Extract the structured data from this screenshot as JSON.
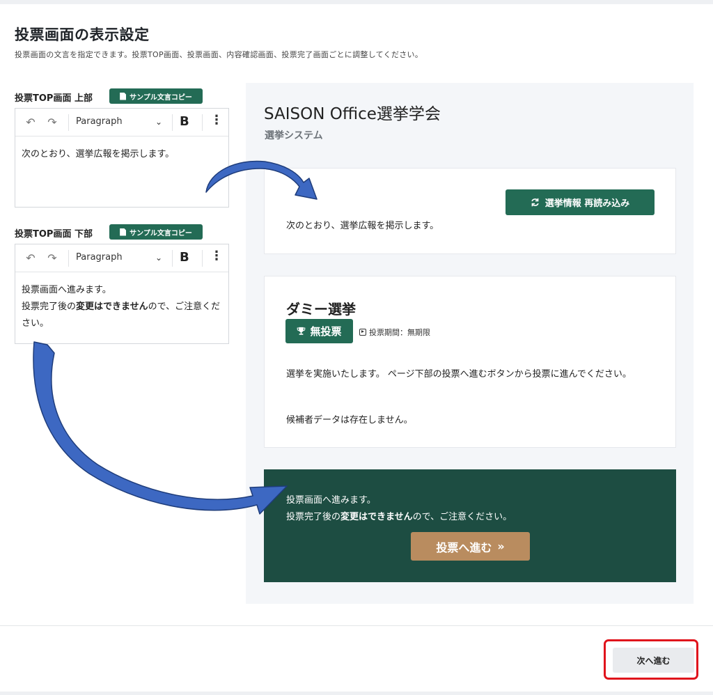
{
  "page": {
    "title": "投票画面の表示設定",
    "description": "投票画面の文言を指定できます。投票TOP画面、投票画面、内容確認画面、投票完了画面ごとに調整してください。"
  },
  "editors": {
    "copy_label": "サンプル文言コピー",
    "paragraph_label": "Paragraph",
    "bold_label": "B",
    "more_label": "⋮",
    "top": {
      "label": "投票TOP画面 上部",
      "text": "次のとおり、選挙広報を掲示します。"
    },
    "bottom": {
      "label": "投票TOP画面 下部",
      "line1": "投票画面へ進みます。",
      "line2_pre": "投票完了後の",
      "line2_bold": "変更はできません",
      "line2_post": "ので、ご注意ください。"
    }
  },
  "preview": {
    "org_name": "SAISON Office選挙学会",
    "system_name": "選挙システム",
    "reload_label": "選挙情報 再読み込み",
    "top_text": "次のとおり、選挙広報を掲示します。",
    "election": {
      "name": "ダミー選挙",
      "badge": "無投票",
      "period": "投票期間：無期限",
      "description": "選挙を実施いたします。 ページ下部の投票へ進むボタンから投票に進んでください。",
      "no_candidates": "候補者データは存在しません。"
    },
    "bottom": {
      "line1": "投票画面へ進みます。",
      "line2_pre": "投票完了後の",
      "line2_bold": "変更はできません",
      "line2_post": "ので、ご注意ください。",
      "vote_button": "投票へ進む",
      "vote_arrow": "»"
    }
  },
  "footer": {
    "next_label": "次へ進む"
  },
  "colors": {
    "primary_green": "#236b55",
    "dark_green_panel": "#1d4d42",
    "vote_button": "#b98c5f",
    "highlight_red": "#e0131c",
    "annotation_arrow": "#3d68c2"
  }
}
